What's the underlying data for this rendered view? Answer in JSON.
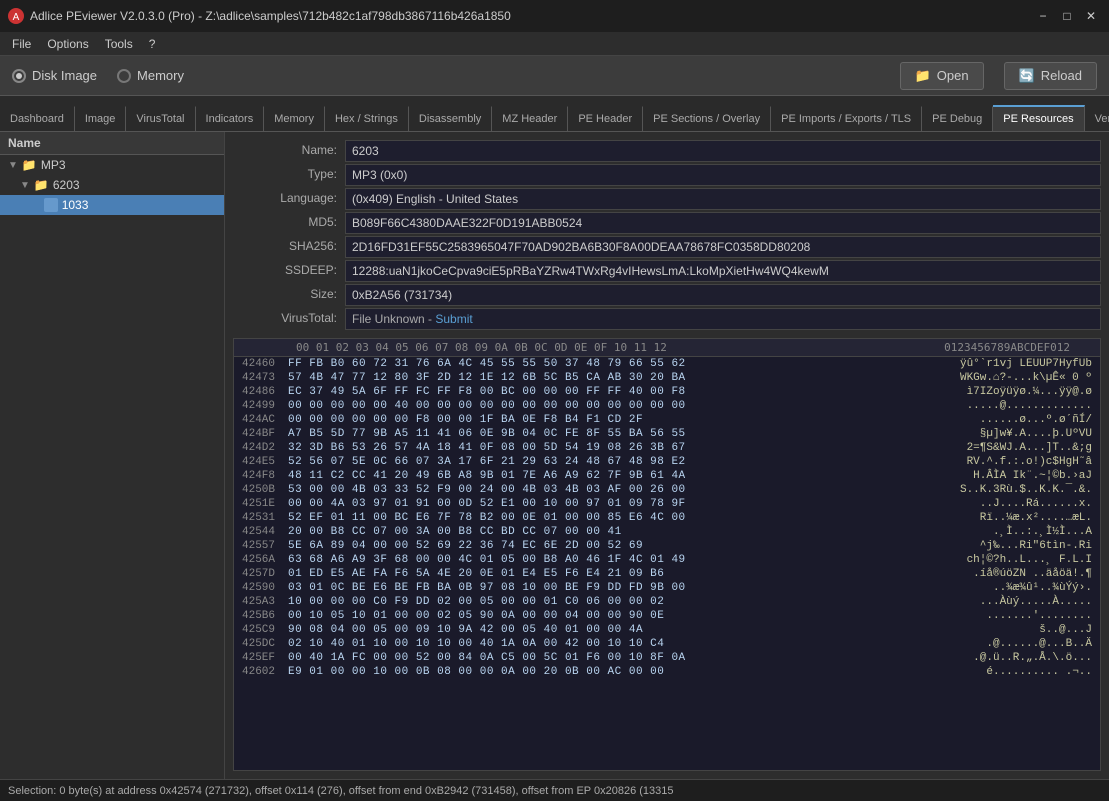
{
  "titlebar": {
    "title": "Adlice PEviewer V2.0.3.0 (Pro) - Z:\\adlice\\samples\\712b482c1af798db3867116b426a1850",
    "icon": "●",
    "controls": {
      "minimize": "−",
      "maximize": "□",
      "close": "✕"
    }
  },
  "menubar": {
    "items": [
      "File",
      "Options",
      "Tools",
      "?"
    ]
  },
  "modebar": {
    "disk_image_label": "Disk Image",
    "memory_label": "Memory",
    "open_label": "Open",
    "reload_label": "Reload"
  },
  "tabs": [
    {
      "id": "dashboard",
      "label": "Dashboard"
    },
    {
      "id": "image",
      "label": "Image"
    },
    {
      "id": "virustotal",
      "label": "VirusTotal"
    },
    {
      "id": "indicators",
      "label": "Indicators"
    },
    {
      "id": "memory",
      "label": "Memory"
    },
    {
      "id": "hex-strings",
      "label": "Hex / Strings"
    },
    {
      "id": "disassembly",
      "label": "Disassembly"
    },
    {
      "id": "mz-header",
      "label": "MZ Header"
    },
    {
      "id": "pe-header",
      "label": "PE Header"
    },
    {
      "id": "pe-sections",
      "label": "PE Sections / Overlay"
    },
    {
      "id": "pe-imports",
      "label": "PE Imports / Exports / TLS"
    },
    {
      "id": "pe-debug",
      "label": "PE Debug"
    },
    {
      "id": "pe-resources",
      "label": "PE Resources"
    },
    {
      "id": "version",
      "label": "Versio..."
    }
  ],
  "active_tab": "pe-resources",
  "tree": {
    "header": "Name",
    "items": [
      {
        "id": "mp3",
        "label": "MP3",
        "level": 1,
        "type": "folder",
        "expanded": true
      },
      {
        "id": "6203",
        "label": "6203",
        "level": 2,
        "type": "folder",
        "expanded": true
      },
      {
        "id": "1033",
        "label": "1033",
        "level": 3,
        "type": "file",
        "selected": true
      }
    ]
  },
  "properties": {
    "name_label": "Name:",
    "name_value": "6203",
    "type_label": "Type:",
    "type_value": "MP3 (0x0)",
    "language_label": "Language:",
    "language_value": "(0x409) English - United States",
    "md5_label": "MD5:",
    "md5_value": "B089F66C4380DAAE322F0D191ABB0524",
    "sha256_label": "SHA256:",
    "sha256_value": "2D16FD31EF55C2583965047F70AD902BA6B30F8A00DEAA78678FC0358DD80208",
    "ssdeep_label": "SSDEEP:",
    "ssdeep_value": "12288:uaN1jkoCeCpva9ciE5pRBaYZRw4TWxRg4vIHewsLmA:LkoMpXietHw4WQ4kewM",
    "size_label": "Size:",
    "size_value": "0xB2A56 (731734)",
    "virustotal_label": "VirusTotal:",
    "virustotal_value": "File Unknown - Submit"
  },
  "hex": {
    "header_offset": "00 01 02 03 04 05 06 07 08 09 0A 0B 0C 0D 0E 0F 10 11 12",
    "ascii_header": "0123456789ABCDEF012",
    "rows": [
      {
        "addr": "42460",
        "bytes": "FF FB B0 60 72 31 76 6A 4C 45 55 55 50 37 48 79 66 55 62",
        "ascii": "ÿû°`r1vj LEUUP7HyfUb"
      },
      {
        "addr": "42473",
        "bytes": "57 4B 47 77 12 80 3F 2D 12 1E 12 6B 5C B5 CA AB 30 20 BA",
        "ascii": "WKGw.⌂?-...k\\µÊ« 0 º"
      },
      {
        "addr": "42486",
        "bytes": "EC 37 49 5A 6F FF FC FF F8 00 BC 00 00 00 FF FF 40 00 F8",
        "ascii": "ì7IZoÿüÿø.¼...ÿÿ@.ø"
      },
      {
        "addr": "42499",
        "bytes": "00 00 00 00 00 40 00 00 00 00 00 00 00 00 00 00 00 00 00",
        "ascii": ".....@............."
      },
      {
        "addr": "424AC",
        "bytes": "00 00 00 00 00 00 F8 00 00 1F BA 0E F8 B4 F1 CD 2F",
        "ascii": "......ø...º.ø´ñÍ/"
      },
      {
        "addr": "424BF",
        "bytes": "A7 B5 5D 77 9B A5 11 41 06 0E 9B 04 0C FE 8F 55 BA 56 55",
        "ascii": "§µ]w¥.A....þ.UºVU"
      },
      {
        "addr": "424D2",
        "bytes": "32 3D B6 53 26 57 4A 18 41 0F 08 00 5D 54 19 08 26 3B 67",
        "ascii": "2=¶S&WJ.A...]T..&;g"
      },
      {
        "addr": "424E5",
        "bytes": "52 56 07 5E 0C 66 07 3A 17 6F 21 29 63 24 48 67 48 98 E2",
        "ascii": "RV.^.f.:.o!)c$HgH˜â"
      },
      {
        "addr": "424F8",
        "bytes": "48 11 C2 CC 41 20 49 6B A8 9B 01 7E A6 A9 62 7F 9B 61 4A",
        "ascii": "H.ÂÌA Ik¨.~¦©b.›aJ"
      },
      {
        "addr": "4250B",
        "bytes": "53 00 00 4B 03 33 52 F9 00 24 00 4B 03 4B 03 AF 00 26 00",
        "ascii": "S..K.3Rù.$..K.K.¯.&."
      },
      {
        "addr": "4251E",
        "bytes": "00 00 4A 03 97 01 91 00 0D 52 E1 00 10 00 97 01 09 78 9F",
        "ascii": "..J....Rá......x."
      },
      {
        "addr": "42531",
        "bytes": "52 EF 01 11 00 BC E6 7F 78 B2 00 0E 01 00 00 85 E6 4C 00",
        "ascii": "Rï..¼æ.x²....…æL."
      },
      {
        "addr": "42544",
        "bytes": "20 00 B8 CC 07 00 3A 00 B8 CC BD CC 07 00 00 41",
        "ascii": " .¸Ì..:.¸Ì½Ì...A"
      },
      {
        "addr": "42557",
        "bytes": "5E 6A 89 04 00 00 52 69 22 36 74 EC 6E 2D 00 52 69",
        "ascii": "^j‰...Ri\"6tìn-.Ri"
      },
      {
        "addr": "4256A",
        "bytes": "63 68 A6 A9 3F 68 00 00 4C 01 05 00 B8 A0 46 1F 4C 01 49",
        "ascii": "ch¦©?h..L...¸ F.L.I"
      },
      {
        "addr": "4257D",
        "bytes": "01 ED E5 AE FA F6 5A 4E 20 0E 01 E4 E5 F6 E4 21 09 B6",
        "ascii": ".íå®úöZN ..äåöä!.¶"
      },
      {
        "addr": "42590",
        "bytes": "03 01 0C BE E6 BE FB BA 0B 97 08 10 00 BE F9 DD FD 9B 00",
        "ascii": "..¾æ¾û¹..¾ùÝý›."
      },
      {
        "addr": "425A3",
        "bytes": "10 00 00 00 C0 F9 DD 02 00 05 00 00 01 C0 06 00 00 02",
        "ascii": "...Àùý.....À....."
      },
      {
        "addr": "425B6",
        "bytes": "00 10 05 10 01 00 00 02 05 90 0A 00 00 04 00 00 90 0E",
        "ascii": ".......'........"
      },
      {
        "addr": "425C9",
        "bytes": "90 08 04 00 05 00 09 10 9A 42 00 05 40 01 00 00 4A",
        "ascii": "š..@...J"
      },
      {
        "addr": "425DC",
        "bytes": "02 10 40 01 10 00 10 10 00 40 1A 0A 00 42 00 10 10 C4",
        "ascii": ".@......@...B..Ä"
      },
      {
        "addr": "425EF",
        "bytes": "00 40 1A FC 00 00 52 00 84 0A C5 00 5C 01 F6 00 10 8F 0A",
        "ascii": ".@.ü..R.„.Å.\\.ö..."
      },
      {
        "addr": "42602",
        "bytes": "E9 01 00 00 10 00 0B 08 00 00 0A 00 20 0B 00 AC 00 00",
        "ascii": "é.......... .¬.."
      }
    ]
  },
  "statusbar": {
    "text": "Selection: 0 byte(s) at address 0x42574 (271732), offset 0x114 (276), offset from end 0xB2942 (731458), offset from EP 0x20826 (13315"
  }
}
